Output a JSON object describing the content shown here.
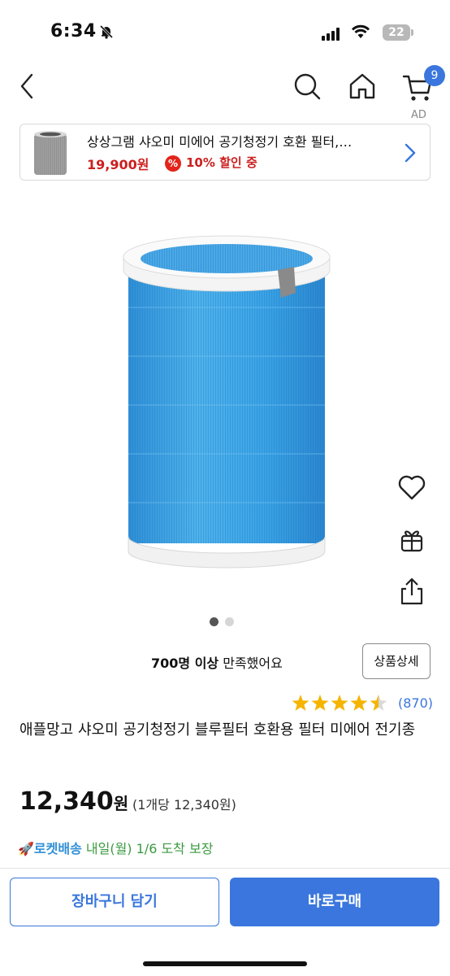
{
  "status_bar": {
    "time": "6:34",
    "battery": "22"
  },
  "ad": {
    "label": "AD",
    "title": "상상그램 샤오미 미에어 공기청정기 호환 필터,…",
    "price": "19,900원",
    "discount_icon": "%",
    "discount": "10% 할인 중"
  },
  "nav": {
    "cart_count": "9",
    "icons": [
      "back-icon",
      "search-icon",
      "home-icon",
      "cart-icon"
    ]
  },
  "gallery": {
    "image_count": 2,
    "current_index": 0
  },
  "satisfaction": {
    "bold": "700명 이상",
    "rest": " 만족했어요"
  },
  "detail_button": "상품상세",
  "rating": {
    "stars": 4.5,
    "review_count": "(870)"
  },
  "product": {
    "title": "애플망고 샤오미 공기청정기 블루필터 호환용 필터 미에어 전기종",
    "price": "12,340",
    "price_unit": "원",
    "unit_price": "(1개당 12,340원)"
  },
  "delivery": {
    "rocket_label": "로켓배송",
    "text": " 내일(월) 1/6 도착 보장"
  },
  "actions": {
    "cart": "장바구니 담기",
    "buy": "바로구매"
  },
  "colors": {
    "accent": "#3a76dd",
    "sale_red": "#cc1f1f",
    "rating_star": "#f5b400",
    "delivery_green": "#3a9a3f"
  }
}
